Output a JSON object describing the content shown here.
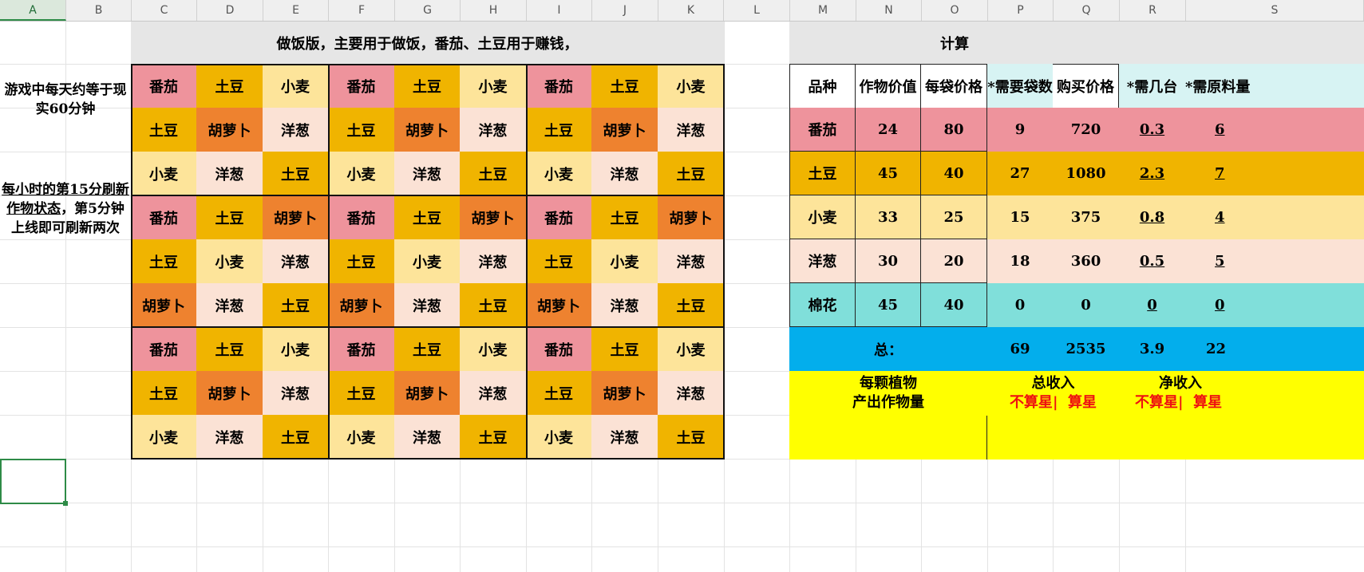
{
  "columns": [
    "A",
    "B",
    "C",
    "D",
    "E",
    "F",
    "G",
    "H",
    "I",
    "J",
    "K",
    "L",
    "M",
    "N",
    "O",
    "P",
    "Q",
    "R",
    "S"
  ],
  "notes": {
    "note1": "游戏中每天约等于现实60分钟",
    "note2_underlined": "每小时的第15分刷新作物状态",
    "note2_rest": "，第5分钟上线即可刷新两次"
  },
  "farm": {
    "title": "做饭版，主要用于做饭，番茄、土豆用于赚钱，",
    "grid": [
      [
        "番茄",
        "土豆",
        "小麦",
        "番茄",
        "土豆",
        "小麦",
        "番茄",
        "土豆",
        "小麦"
      ],
      [
        "土豆",
        "胡萝卜",
        "洋葱",
        "土豆",
        "胡萝卜",
        "洋葱",
        "土豆",
        "胡萝卜",
        "洋葱"
      ],
      [
        "小麦",
        "洋葱",
        "土豆",
        "小麦",
        "洋葱",
        "土豆",
        "小麦",
        "洋葱",
        "土豆"
      ],
      [
        "番茄",
        "土豆",
        "胡萝卜",
        "番茄",
        "土豆",
        "胡萝卜",
        "番茄",
        "土豆",
        "胡萝卜"
      ],
      [
        "土豆",
        "小麦",
        "洋葱",
        "土豆",
        "小麦",
        "洋葱",
        "土豆",
        "小麦",
        "洋葱"
      ],
      [
        "胡萝卜",
        "洋葱",
        "土豆",
        "胡萝卜",
        "洋葱",
        "土豆",
        "胡萝卜",
        "洋葱",
        "土豆"
      ],
      [
        "番茄",
        "土豆",
        "小麦",
        "番茄",
        "土豆",
        "小麦",
        "番茄",
        "土豆",
        "小麦"
      ],
      [
        "土豆",
        "胡萝卜",
        "洋葱",
        "土豆",
        "胡萝卜",
        "洋葱",
        "土豆",
        "胡萝卜",
        "洋葱"
      ],
      [
        "小麦",
        "洋葱",
        "土豆",
        "小麦",
        "洋葱",
        "土豆",
        "小麦",
        "洋葱",
        "土豆"
      ]
    ]
  },
  "calc": {
    "title": "计算",
    "headers": [
      "品种",
      "作物价值",
      "每袋价格",
      "*需要袋数",
      "购买价格",
      "*需几台",
      "*需原料量"
    ],
    "rows": [
      {
        "name": "番茄",
        "value": "24",
        "bag_price": "80",
        "bags": "9",
        "cost": "720",
        "machines": "0.3",
        "raw": "6"
      },
      {
        "name": "土豆",
        "value": "45",
        "bag_price": "40",
        "bags": "27",
        "cost": "1080",
        "machines": "2.3",
        "raw": "7"
      },
      {
        "name": "小麦",
        "value": "33",
        "bag_price": "25",
        "bags": "15",
        "cost": "375",
        "machines": "0.8",
        "raw": "4"
      },
      {
        "name": "洋葱",
        "value": "30",
        "bag_price": "20",
        "bags": "18",
        "cost": "360",
        "machines": "0.5",
        "raw": "5"
      },
      {
        "name": "棉花",
        "value": "45",
        "bag_price": "40",
        "bags": "0",
        "cost": "0",
        "machines": "0",
        "raw": "0"
      }
    ],
    "total_label": "总：",
    "totals": {
      "bags": "69",
      "cost": "2535",
      "machines": "3.9",
      "raw": "22"
    },
    "yield_label_1": "每颗植物",
    "yield_label_2": "产出作物量",
    "gross_label": "总收入",
    "net_label": "净收入",
    "no_star": "不算星",
    "separator": "|",
    "with_star": "算星"
  },
  "colors": {
    "tomato": "#ee939c",
    "potato": "#f0b400",
    "wheat": "#fde49a",
    "onion": "#fbe2d5",
    "carrot": "#ee822f",
    "cotton": "#80dfda",
    "total_blue": "#03aeec",
    "yellow": "#ffff00"
  }
}
